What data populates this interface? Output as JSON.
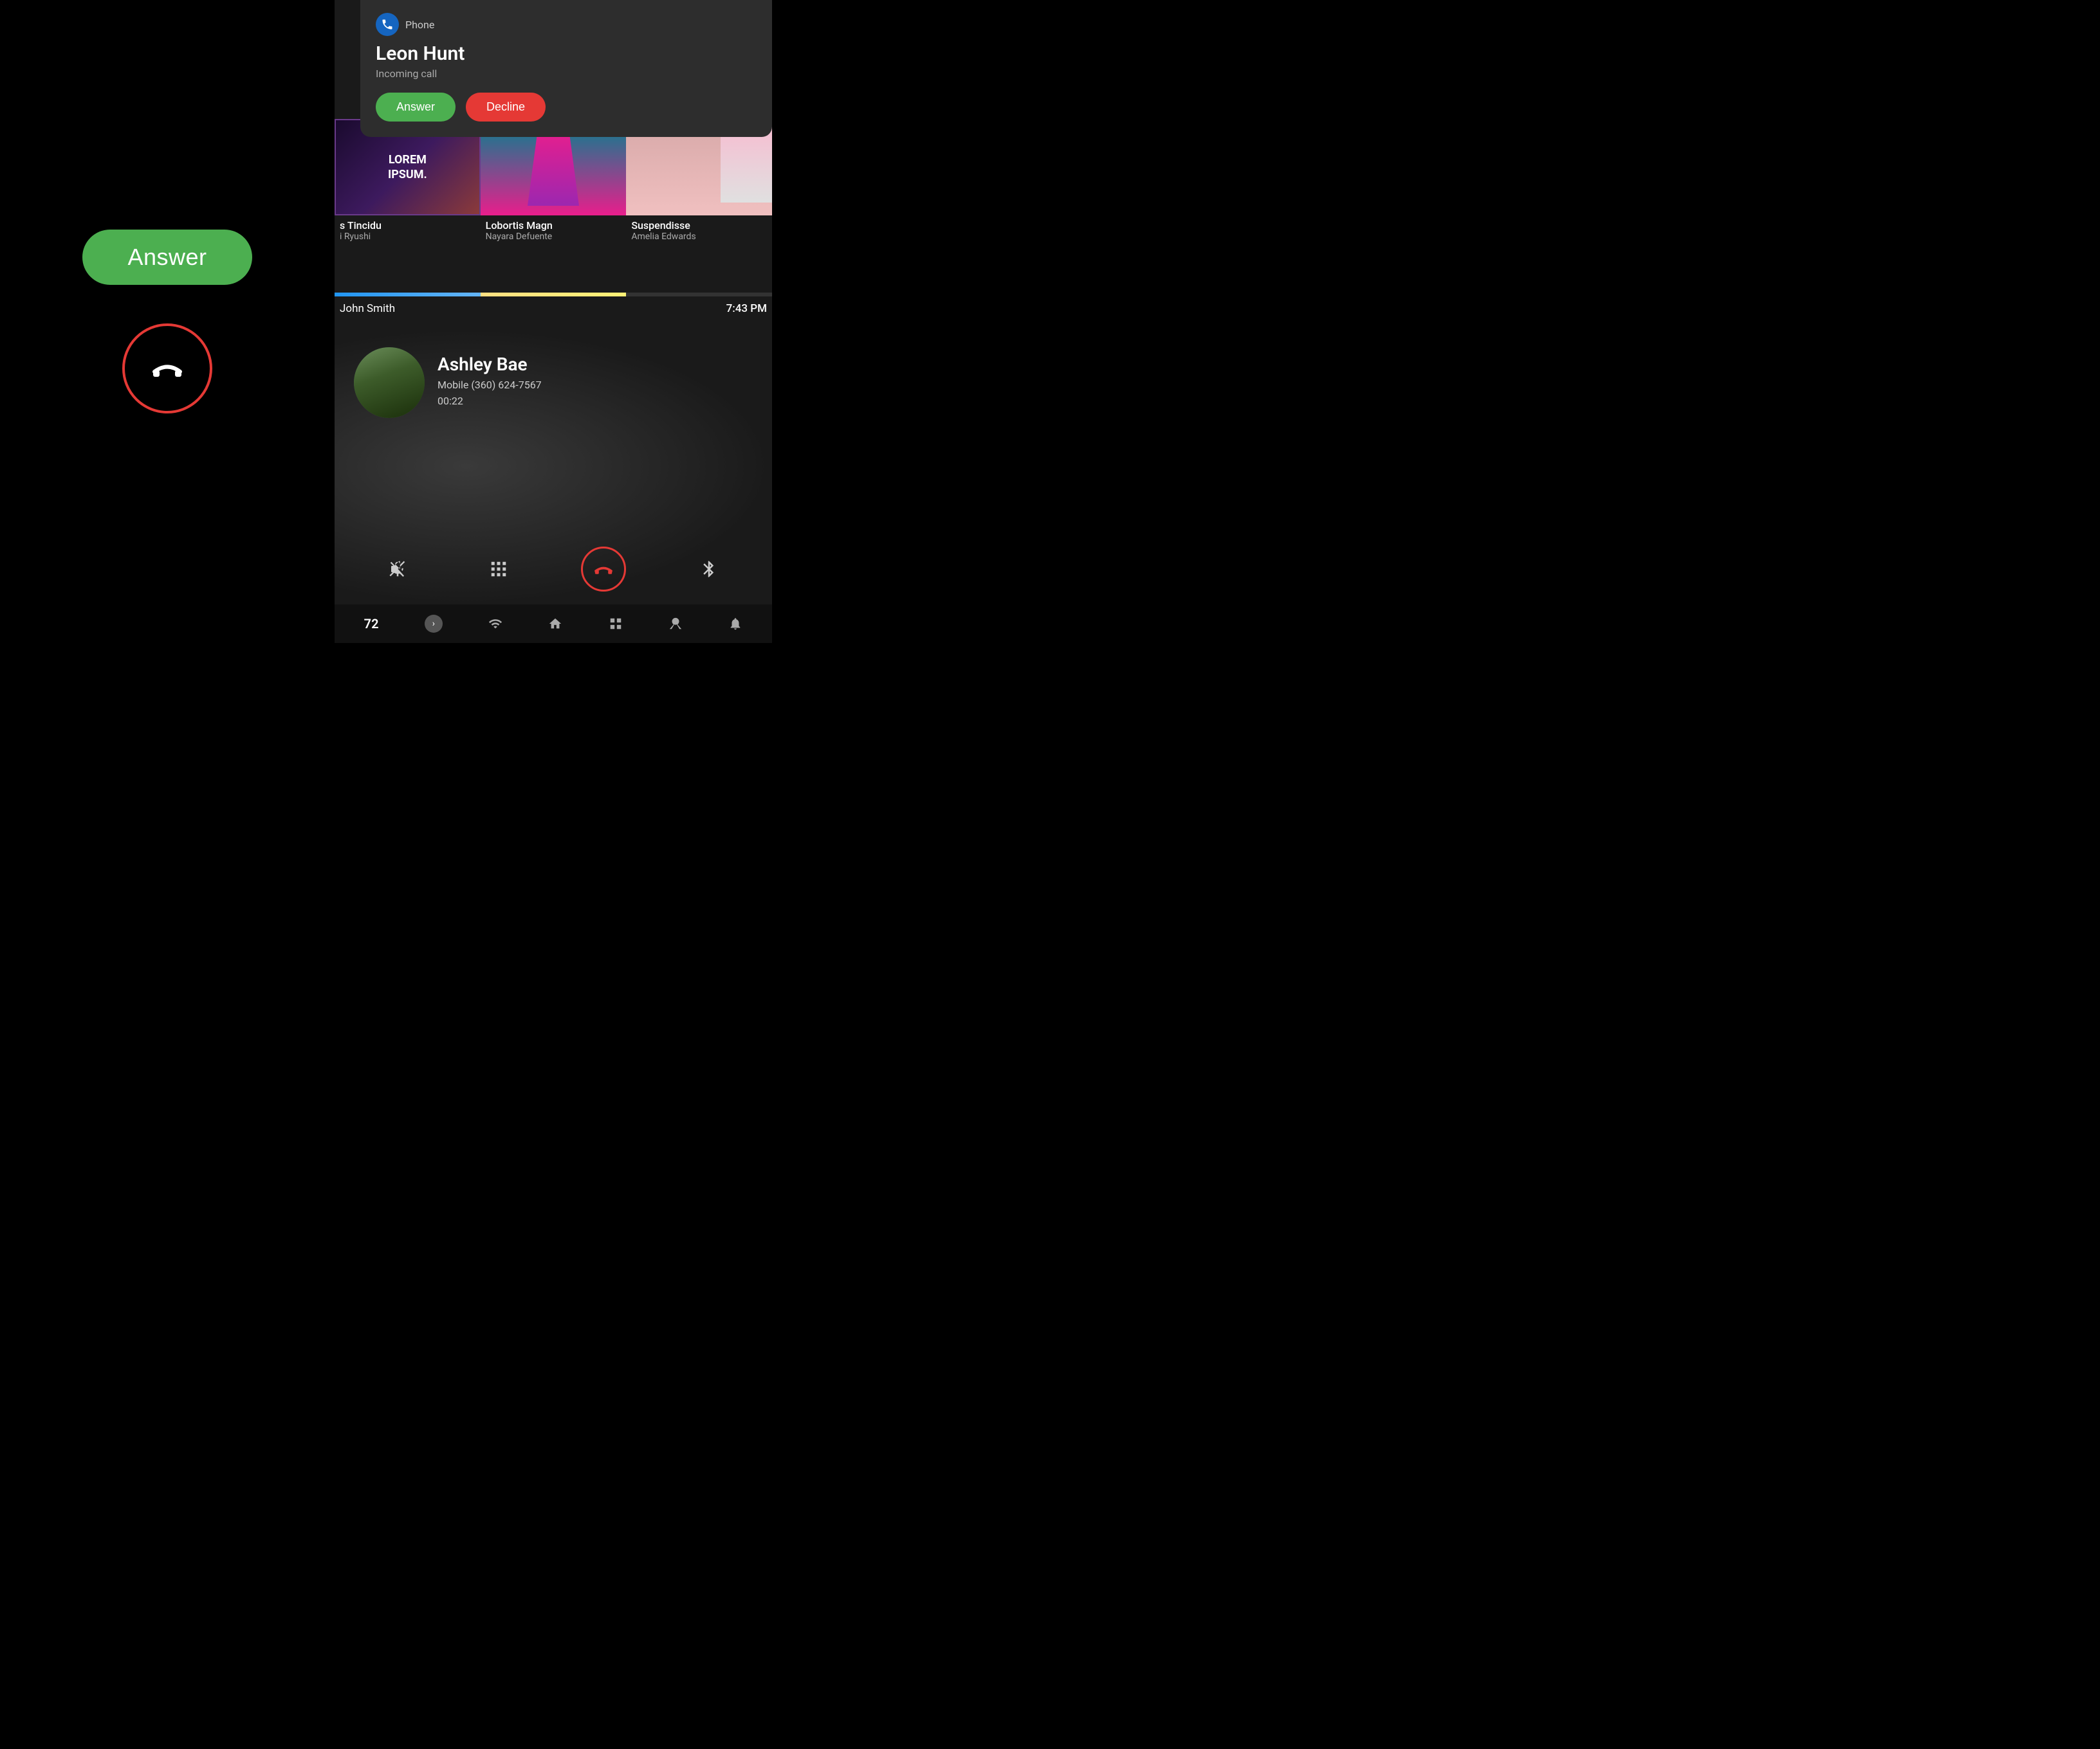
{
  "left_panel": {
    "answer_button_label": "Answer",
    "decline_button_label": "Decline"
  },
  "notification": {
    "app_name": "Phone",
    "caller_name": "Leon Hunt",
    "subtitle": "Incoming call",
    "answer_label": "Answer",
    "decline_label": "Decline"
  },
  "media_cards": [
    {
      "title": "s Tincidu",
      "author": "i Ryushi",
      "lorem": "LOREM\nIPSUM."
    },
    {
      "title": "Lobortis Magn",
      "author": "Nayara Defuente"
    },
    {
      "title": "Suspendisse",
      "author": "Amelia Edwards"
    }
  ],
  "track": {
    "name": "John Smith",
    "time": "7:43 PM"
  },
  "call": {
    "caller_name": "Ashley Bae",
    "caller_number": "Mobile (360) 624-7567",
    "duration": "00:22"
  },
  "bottom_nav": {
    "badge": "72",
    "icons": [
      "arrow-icon",
      "signal-icon",
      "home-icon",
      "grid-icon",
      "fan-icon",
      "bell-icon"
    ]
  }
}
